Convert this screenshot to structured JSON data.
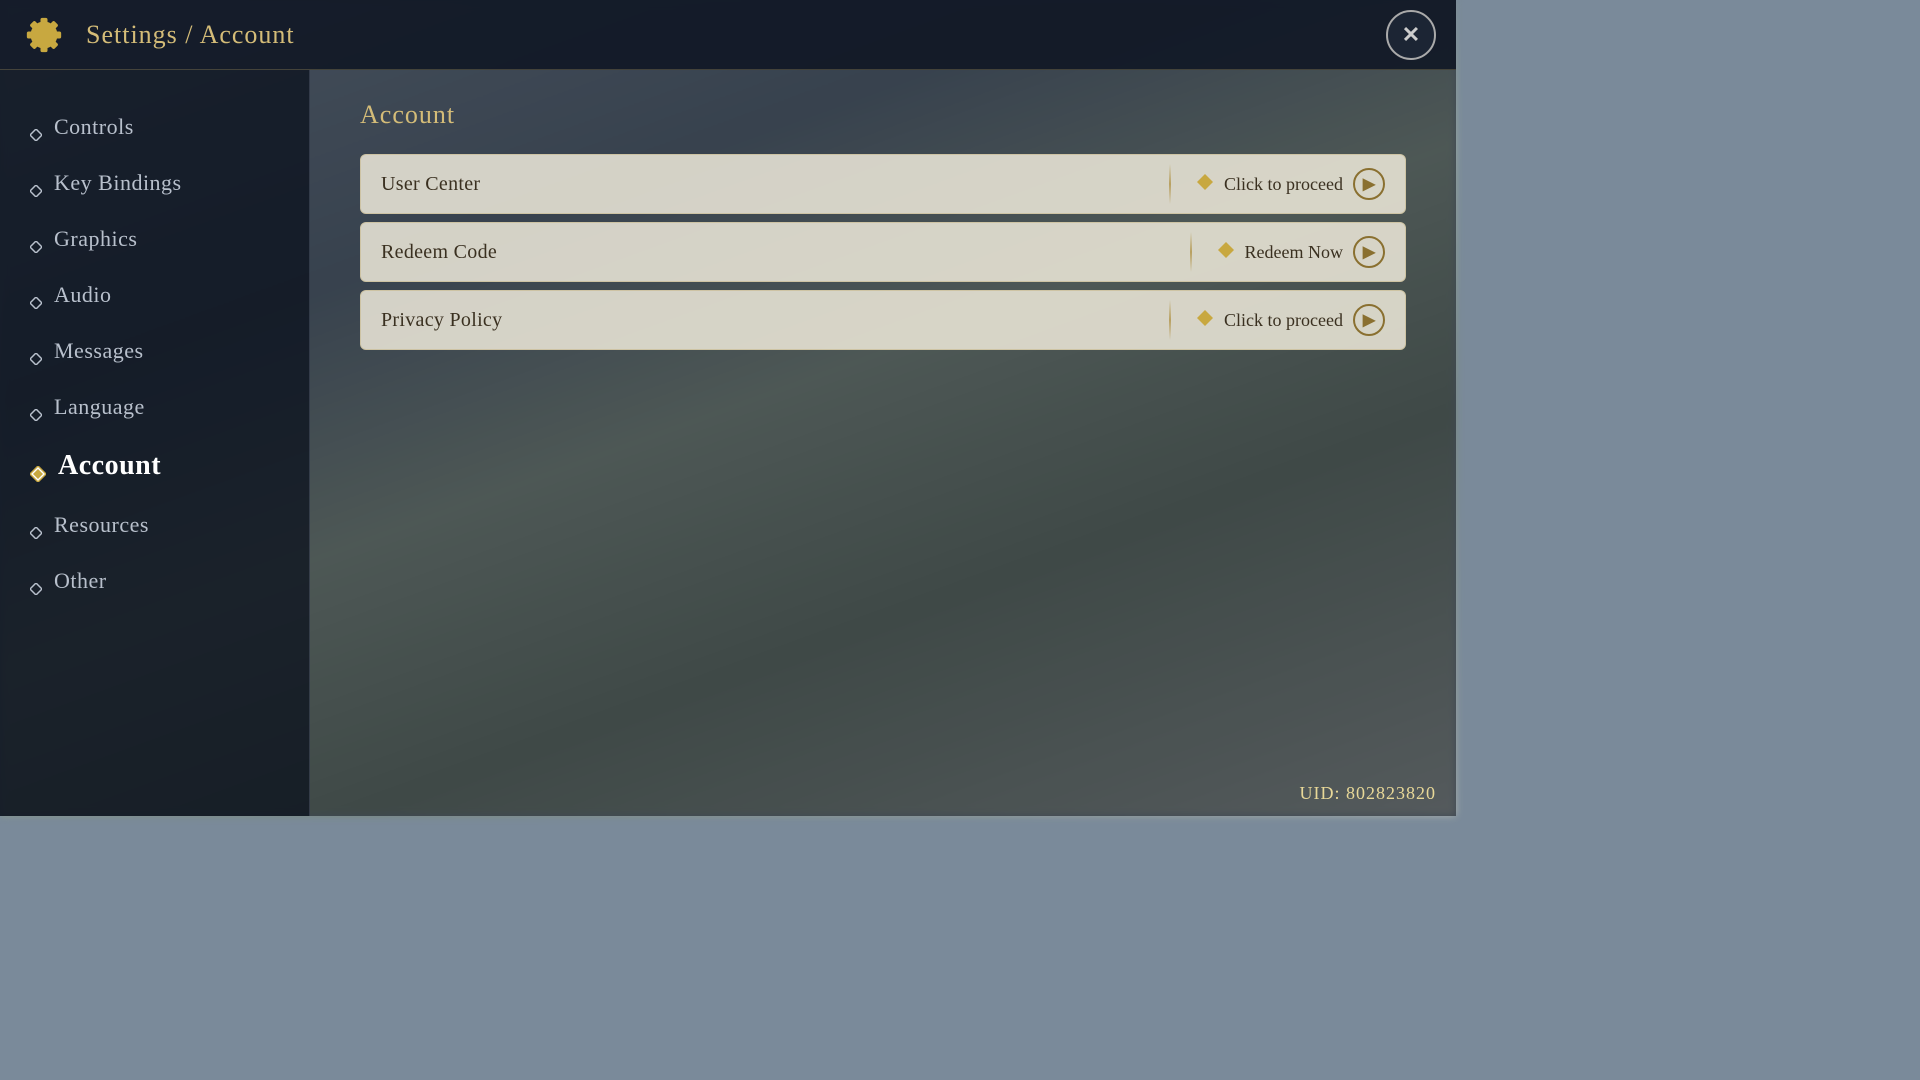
{
  "header": {
    "title": "Settings / Account",
    "close_label": "✕",
    "icon": "gear"
  },
  "sidebar": {
    "items": [
      {
        "id": "controls",
        "label": "Controls",
        "active": false
      },
      {
        "id": "key-bindings",
        "label": "Key Bindings",
        "active": false
      },
      {
        "id": "graphics",
        "label": "Graphics",
        "active": false
      },
      {
        "id": "audio",
        "label": "Audio",
        "active": false
      },
      {
        "id": "messages",
        "label": "Messages",
        "active": false
      },
      {
        "id": "language",
        "label": "Language",
        "active": false
      },
      {
        "id": "account",
        "label": "Account",
        "active": true
      },
      {
        "id": "resources",
        "label": "Resources",
        "active": false
      },
      {
        "id": "other",
        "label": "Other",
        "active": false
      }
    ]
  },
  "content": {
    "title": "Account",
    "rows": [
      {
        "id": "user-center",
        "label": "User Center",
        "action": "Click to proceed"
      },
      {
        "id": "redeem-code",
        "label": "Redeem Code",
        "action": "Redeem Now"
      },
      {
        "id": "privacy-policy",
        "label": "Privacy Policy",
        "action": "Click to proceed"
      }
    ]
  },
  "uid": {
    "label": "UID: 802823820"
  }
}
